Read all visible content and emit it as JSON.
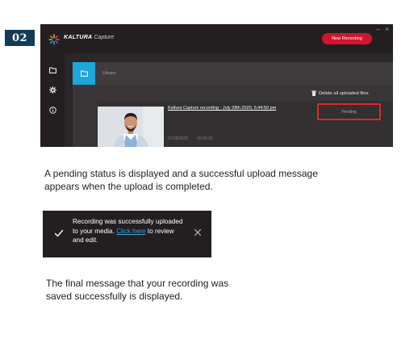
{
  "step": {
    "number": "02"
  },
  "app": {
    "brand": "KALTURA",
    "product": "Capture",
    "new_recording_label": "New Recording",
    "minimize_label": "–",
    "close_label": "×",
    "sidebar_icons": [
      "folder-icon",
      "gear-icon",
      "info-icon"
    ],
    "library": {
      "title": "Library",
      "delete_all_label": "Delete all uploaded files",
      "recording": {
        "title": "Kaltura Capture recording - July 28th 2020, 5:44:50 pm",
        "date": "07/28/2020",
        "duration": "00:00:10",
        "status": "Pending"
      }
    }
  },
  "caption_1": "A pending status is displayed and a successful upload message appears when the upload is completed.",
  "toast": {
    "msg_prefix": "Recording was successfully uploaded to your media.",
    "link_text": "Click here",
    "msg_suffix": "to review and edit.",
    "close_icon": "close-icon",
    "check_icon": "check-icon"
  },
  "caption_2": "The final message that your recording was saved successfully is displayed.",
  "colors": {
    "badge": "#143a56",
    "accent_red": "#d0162c",
    "accent_blue": "#1da6d8",
    "link": "#2aa6e0",
    "app_dark": "#231f21"
  }
}
